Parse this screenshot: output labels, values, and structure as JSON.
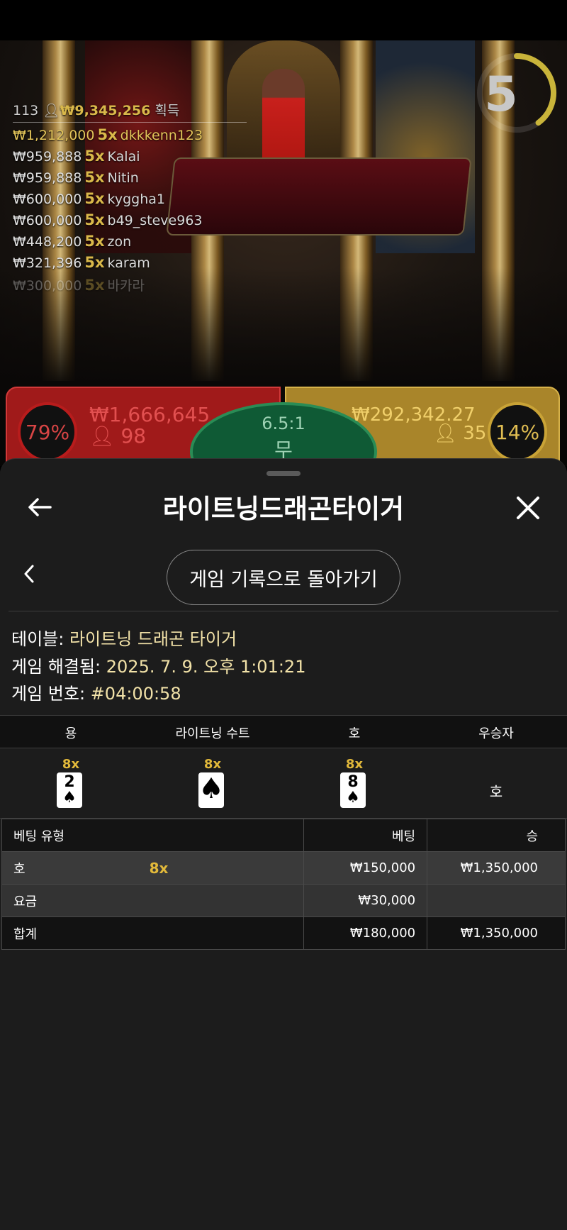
{
  "stage": {
    "stats": {
      "players": "113",
      "total": "₩9,345,256",
      "suffix": "획득"
    },
    "leaderboard": [
      {
        "amount": "₩1,212,000",
        "mult": "5x",
        "name": "dkkkenn123"
      },
      {
        "amount": "₩959,888",
        "mult": "5x",
        "name": "Kalai"
      },
      {
        "amount": "₩959,888",
        "mult": "5x",
        "name": "Nitin"
      },
      {
        "amount": "₩600,000",
        "mult": "5x",
        "name": "kyggha1"
      },
      {
        "amount": "₩600,000",
        "mult": "5x",
        "name": "b49_steve963"
      },
      {
        "amount": "₩448,200",
        "mult": "5x",
        "name": "zon"
      },
      {
        "amount": "₩321,396",
        "mult": "5x",
        "name": "karam"
      },
      {
        "amount": "₩300,000",
        "mult": "5x",
        "name": "바카라"
      }
    ],
    "timer": "5",
    "timer_fraction": 0.4,
    "dragon": {
      "percent": "79%",
      "amount": "₩1,666,645",
      "players": "98"
    },
    "tie": {
      "ratio": "6.5:1",
      "label": "무"
    },
    "tiger": {
      "percent": "14%",
      "amount": "₩292,342.27",
      "players": "35"
    }
  },
  "sheet": {
    "title": "라이트닝드래곤타이거",
    "history_button": "게임 기록으로 돌아가기",
    "info": {
      "table_label": "테이블:",
      "table_value": "라이트닝 드래곤 타이거",
      "resolved_label": "게임 해결됨:",
      "resolved_value": "2025. 7. 9. 오후 1:01:21",
      "number_label": "게임 번호:",
      "number_value": "#04:00:58"
    },
    "cards": {
      "headers": [
        "용",
        "라이트닝 수트",
        "호",
        "우승자"
      ],
      "dragon": {
        "mult": "8x",
        "rank": "2",
        "suit": "♠"
      },
      "lightning": {
        "mult": "8x",
        "suit": "♠"
      },
      "tiger": {
        "mult": "8x",
        "rank": "8",
        "suit": "♠"
      },
      "winner": "호"
    },
    "bets": {
      "headers": [
        "베팅 유형",
        "베팅",
        "승"
      ],
      "rows": [
        {
          "type": "호",
          "mult": "8x",
          "bet": "₩150,000",
          "win": "₩1,350,000"
        },
        {
          "type": "요금",
          "bet": "₩30,000",
          "win": ""
        },
        {
          "type": "합계",
          "bet": "₩180,000",
          "win": "₩1,350,000"
        }
      ]
    }
  },
  "colors": {
    "dragon": "#a01a1a",
    "tiger": "#a9852a",
    "tie": "#0f5a35",
    "gold": "#e2b93a"
  }
}
